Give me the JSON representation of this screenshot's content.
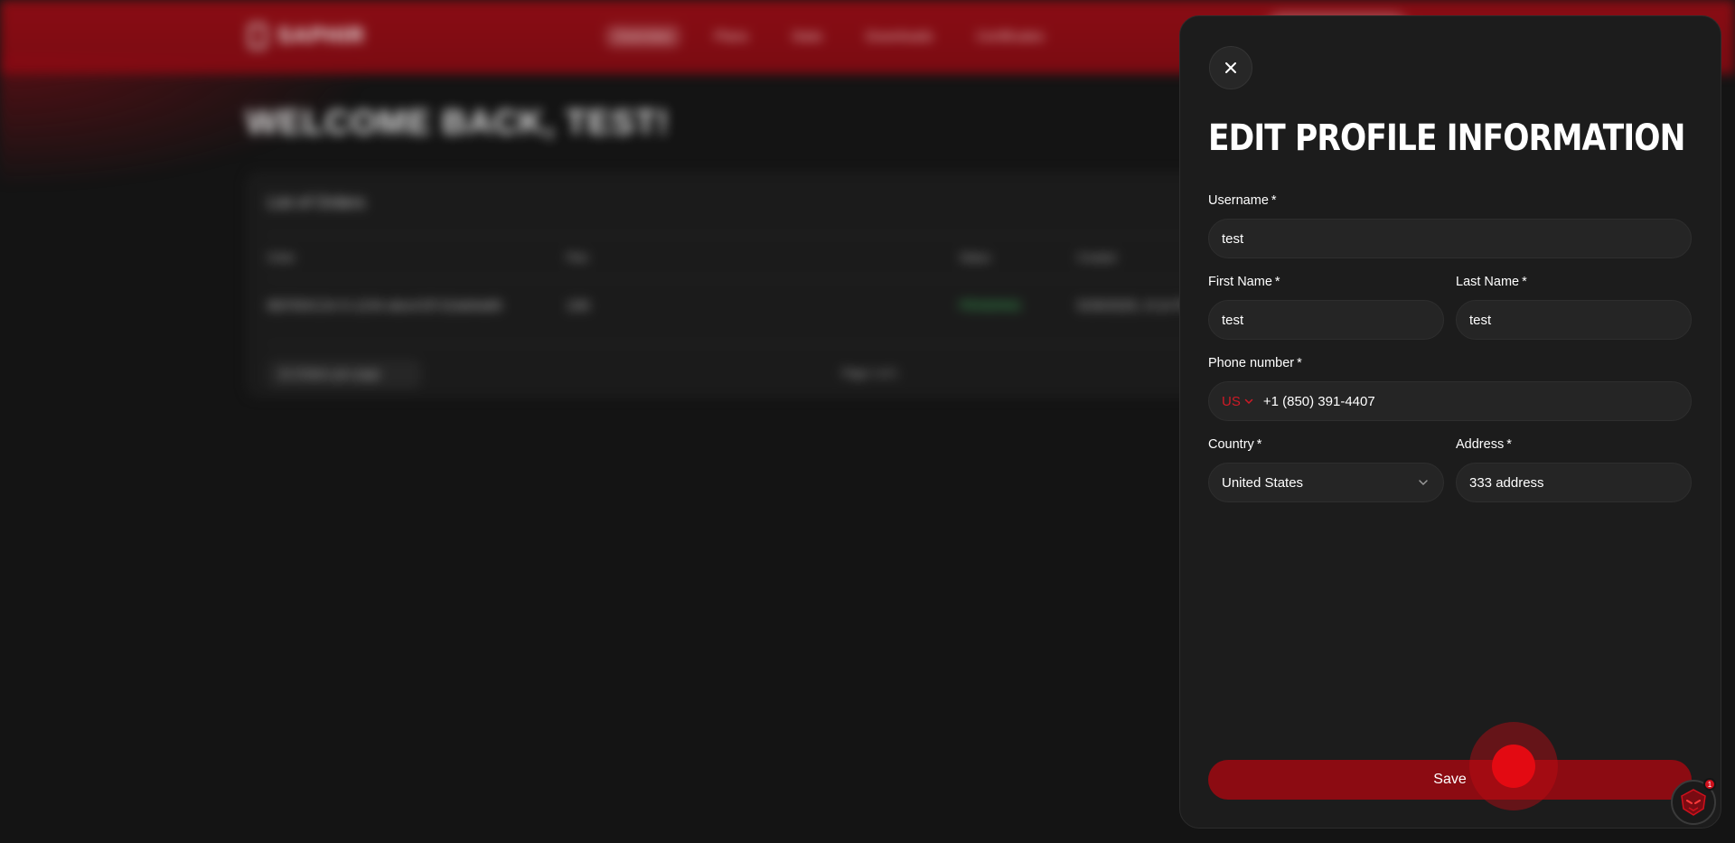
{
  "background": {
    "brand": "SAPHIR",
    "nav": [
      "Overview",
      "Plans",
      "Stats",
      "Downloads",
      "Certificates"
    ],
    "page_title": "WELCOME BACK, TEST!",
    "card_title": "List of Orders",
    "table_headers": [
      "Order",
      "Plan",
      "Status",
      "Created"
    ],
    "table_row": [
      "BEFB3C2A-5-1234-abcd-EF1Dab6a86",
      "10K",
      "PENDING",
      "5/26/2025, 9:14 PM"
    ],
    "pager_label": "10 Orders per page",
    "pager_info": "Page 1 of 1"
  },
  "modal": {
    "title": "EDIT PROFILE INFORMATION",
    "username": {
      "label": "Username",
      "required": "*",
      "value": "test"
    },
    "first_name": {
      "label": "First Name",
      "required": "*",
      "value": "test"
    },
    "last_name": {
      "label": "Last Name",
      "required": "*",
      "value": "test"
    },
    "phone": {
      "label": "Phone number",
      "required": "*",
      "country_code": "US",
      "value": "+1 (850) 391-4407"
    },
    "country": {
      "label": "Country",
      "required": "*",
      "value": "United States"
    },
    "address": {
      "label": "Address",
      "required": "*",
      "value": "333 address"
    },
    "save_label": "Save"
  },
  "avatar_badge": "1",
  "colors": {
    "accent": "#8c0b12",
    "accent_bright": "#e30a12",
    "panel": "#1c1c1c",
    "input": "#252525",
    "background": "#141414"
  }
}
